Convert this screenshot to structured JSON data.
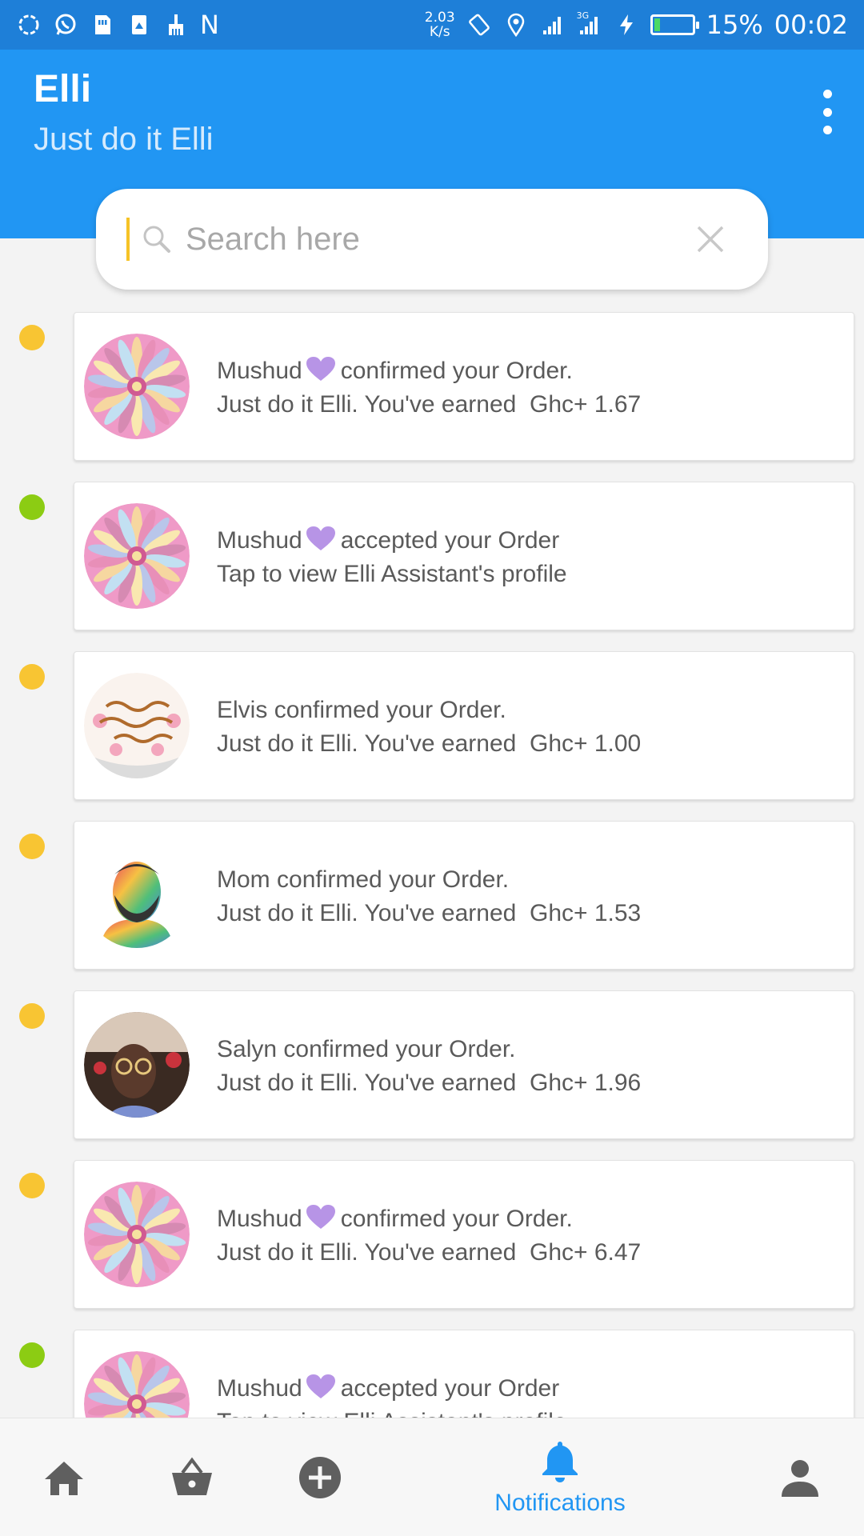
{
  "status_bar": {
    "speed_value": "2.03",
    "speed_unit": "K/s",
    "network_label": "3G",
    "battery_percent": "15%",
    "battery_level": 0.15,
    "time": "00:02",
    "left_icons": [
      "sync-icon",
      "whatsapp-icon",
      "sim-icon",
      "storage-icon",
      "broom-icon",
      "n-icon"
    ],
    "n_label": "N"
  },
  "app_bar": {
    "title": "Elli",
    "subtitle": "Just do it Elli",
    "color": "#2196f3"
  },
  "search": {
    "placeholder": "Search here",
    "value": ""
  },
  "notifications": [
    {
      "dot_color": "#f8c533",
      "name": "Mushud",
      "heart": true,
      "action": "confirmed your Order.",
      "line2": "Just do it Elli. You've earned  Ghc+ 1.67",
      "avatar": "flower"
    },
    {
      "dot_color": "#8ccc13",
      "name": "Mushud",
      "heart": true,
      "action": "accepted your Order",
      "line2": "Tap to view Elli Assistant's profile",
      "avatar": "flower"
    },
    {
      "dot_color": "#f8c533",
      "name": "Elvis",
      "heart": false,
      "action": "confirmed your Order.",
      "line2": "Just do it Elli. You've earned  Ghc+ 1.00",
      "avatar": "cake"
    },
    {
      "dot_color": "#f8c533",
      "name": "Mom",
      "heart": false,
      "action": "confirmed your Order.",
      "line2": "Just do it Elli. You've earned  Ghc+ 1.53",
      "avatar": "portrait"
    },
    {
      "dot_color": "#f8c533",
      "name": "Salyn",
      "heart": false,
      "action": "confirmed your Order.",
      "line2": "Just do it Elli. You've earned  Ghc+ 1.96",
      "avatar": "photo"
    },
    {
      "dot_color": "#f8c533",
      "name": "Mushud",
      "heart": true,
      "action": "confirmed your Order.",
      "line2": "Just do it Elli. You've earned  Ghc+ 6.47",
      "avatar": "flower"
    },
    {
      "dot_color": "#8ccc13",
      "name": "Mushud",
      "heart": true,
      "action": "accepted your Order",
      "line2": "Tap to view Elli Assistant's profile",
      "avatar": "flower"
    }
  ],
  "bottom_nav": {
    "items": [
      {
        "icon": "home-icon"
      },
      {
        "icon": "basket-icon"
      },
      {
        "icon": "add-circle-icon"
      },
      {
        "icon": "bell-icon",
        "label": "Notifications",
        "active": true
      },
      {
        "icon": "person-icon"
      }
    ],
    "active_color": "#2196f3",
    "inactive_color": "#5f5f5f"
  }
}
